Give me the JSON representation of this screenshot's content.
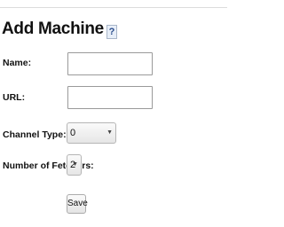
{
  "page": {
    "title": "Add Machine",
    "help_symbol": "?"
  },
  "form": {
    "name": {
      "label": "Name:",
      "value": ""
    },
    "url": {
      "label": "URL:",
      "value": ""
    },
    "channel_type": {
      "label": "Channel Type:",
      "selected": "0"
    },
    "fetchers": {
      "label": "Number of Fetchers:",
      "selected": "2"
    },
    "save_label": "Save"
  },
  "icons": {
    "help": "question-mark-icon",
    "dropdown": "chevron-down-icon"
  }
}
